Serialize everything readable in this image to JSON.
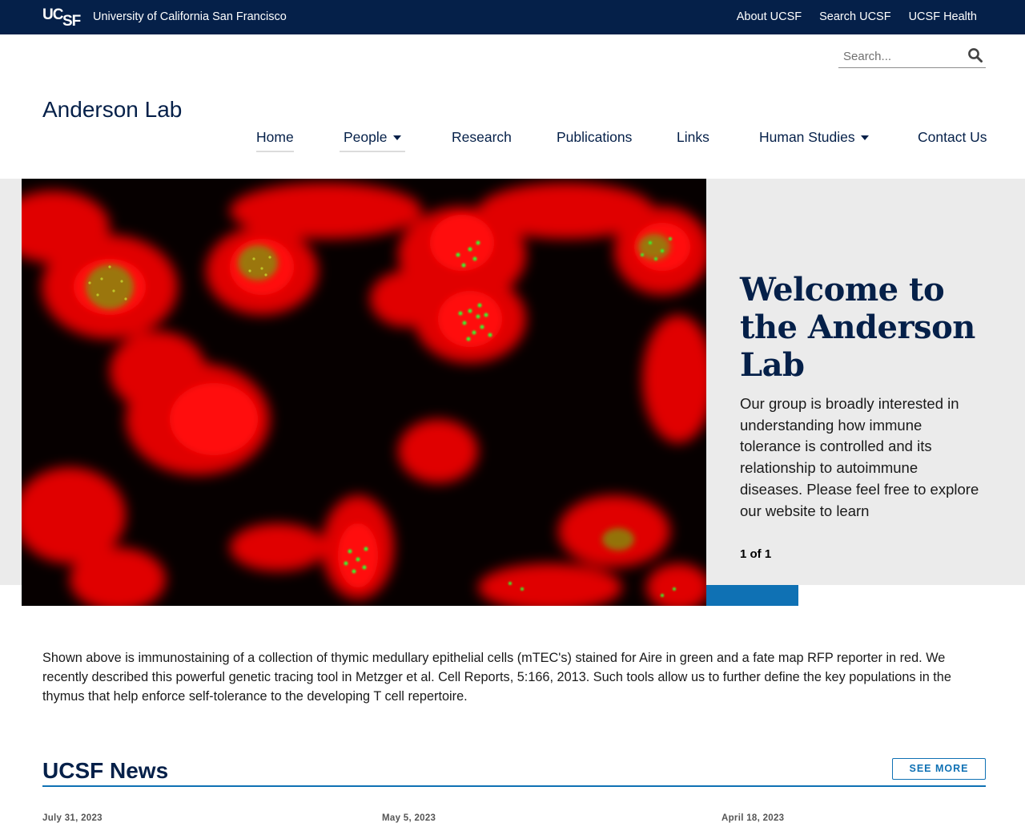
{
  "topbar": {
    "logo_text_top": "UC",
    "logo_text_bottom": "SF",
    "university": "University of California San Francisco",
    "links": [
      "About UCSF",
      "Search UCSF",
      "UCSF Health"
    ]
  },
  "search": {
    "placeholder": "Search..."
  },
  "site_title": "Anderson Lab",
  "nav": {
    "items": [
      {
        "label": "Home",
        "active": true,
        "dropdown": false
      },
      {
        "label": "People",
        "active": true,
        "dropdown": true
      },
      {
        "label": "Research",
        "active": false,
        "dropdown": false
      },
      {
        "label": "Publications",
        "active": false,
        "dropdown": false
      },
      {
        "label": "Links",
        "active": false,
        "dropdown": false
      },
      {
        "label": "Human Studies",
        "active": false,
        "dropdown": true
      },
      {
        "label": "Contact Us",
        "active": false,
        "dropdown": false
      }
    ]
  },
  "hero": {
    "title": "Welcome to the Anderson Lab",
    "text": "Our group is broadly interested in understanding how immune tolerance is controlled and its relationship to autoimmune diseases.  Please feel free to explore our website to learn",
    "counter": "1 of 1"
  },
  "caption": "Shown above is immunostaining of a collection of thymic medullary epithelial cells (mTEC's) stained for Aire in green and a fate map RFP reporter in red.  We recently described this powerful genetic tracing tool in Metzger et al. Cell Reports, 5:166, 2013.  Such tools allow us to further define the key populations in the thymus that help enforce self-tolerance to the developing T cell repertoire.",
  "news": {
    "title": "UCSF News",
    "see_more": "SEE MORE",
    "dates": [
      "July 31, 2023",
      "May 5, 2023",
      "April 18, 2023"
    ]
  },
  "colors": {
    "navy": "#052049",
    "accent_blue": "#0f71b4",
    "hero_bg": "#ebebeb"
  },
  "icons": [
    "ucsf-logo",
    "search-icon",
    "caret-down-icon"
  ]
}
